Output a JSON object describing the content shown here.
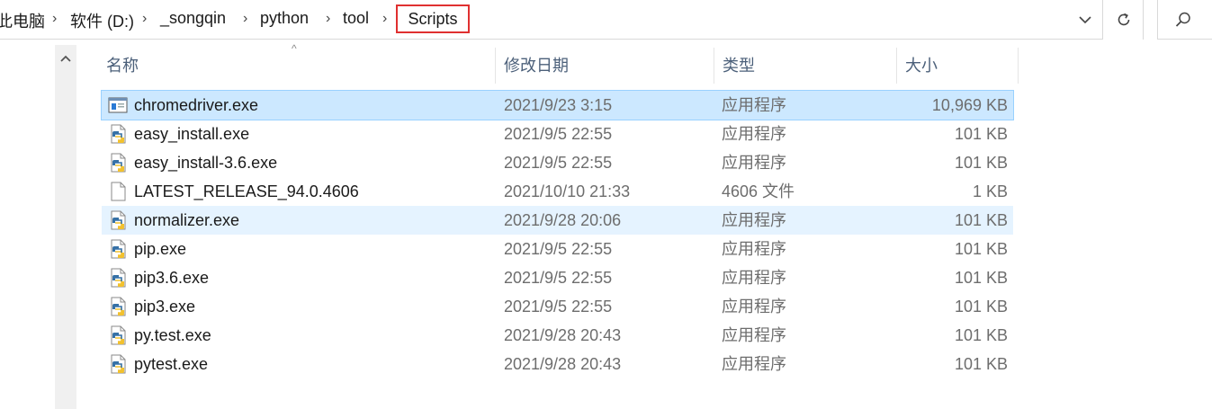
{
  "address": {
    "crumbs": [
      "此电脑",
      "软件 (D:)",
      "_songqin",
      "python",
      "tool"
    ],
    "current": "Scripts",
    "highlight_color": "#e03030"
  },
  "columns": {
    "name": "名称",
    "date": "修改日期",
    "type": "类型",
    "size": "大小"
  },
  "files": [
    {
      "name": "chromedriver.exe",
      "date": "2021/9/23 3:15",
      "type": "应用程序",
      "size": "10,969 KB",
      "icon": "exe-window-icon",
      "state": "selected"
    },
    {
      "name": "easy_install.exe",
      "date": "2021/9/5 22:55",
      "type": "应用程序",
      "size": "101 KB",
      "icon": "python-file-icon",
      "state": ""
    },
    {
      "name": "easy_install-3.6.exe",
      "date": "2021/9/5 22:55",
      "type": "应用程序",
      "size": "101 KB",
      "icon": "python-file-icon",
      "state": ""
    },
    {
      "name": "LATEST_RELEASE_94.0.4606",
      "date": "2021/10/10 21:33",
      "type": "4606 文件",
      "size": "1 KB",
      "icon": "blank-file-icon",
      "state": ""
    },
    {
      "name": "normalizer.exe",
      "date": "2021/9/28 20:06",
      "type": "应用程序",
      "size": "101 KB",
      "icon": "python-file-icon",
      "state": "hover"
    },
    {
      "name": "pip.exe",
      "date": "2021/9/5 22:55",
      "type": "应用程序",
      "size": "101 KB",
      "icon": "python-file-icon",
      "state": ""
    },
    {
      "name": "pip3.6.exe",
      "date": "2021/9/5 22:55",
      "type": "应用程序",
      "size": "101 KB",
      "icon": "python-file-icon",
      "state": ""
    },
    {
      "name": "pip3.exe",
      "date": "2021/9/5 22:55",
      "type": "应用程序",
      "size": "101 KB",
      "icon": "python-file-icon",
      "state": ""
    },
    {
      "name": "py.test.exe",
      "date": "2021/9/28 20:43",
      "type": "应用程序",
      "size": "101 KB",
      "icon": "python-file-icon",
      "state": ""
    },
    {
      "name": "pytest.exe",
      "date": "2021/9/28 20:43",
      "type": "应用程序",
      "size": "101 KB",
      "icon": "python-file-icon",
      "state": ""
    }
  ]
}
